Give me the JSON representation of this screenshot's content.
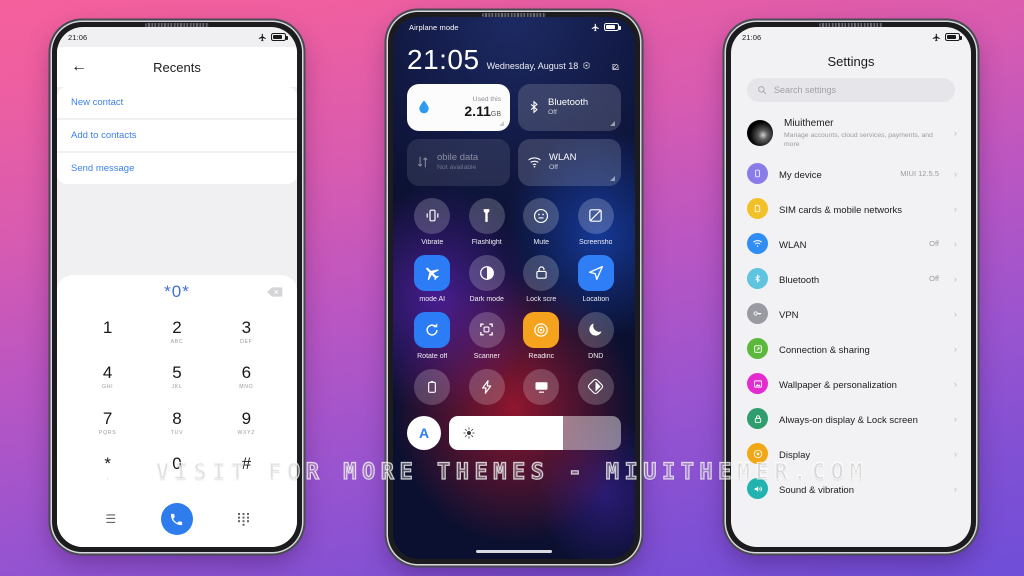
{
  "background": {
    "top_color": "#f5609c",
    "bottom_color": "#6f4ed8"
  },
  "watermark": {
    "text": "VISIT FOR MORE THEMES - MIUITHEMER.COM"
  },
  "left_phone": {
    "status_bar": {
      "time": "21:06",
      "airplane_icon": "airplane-icon",
      "battery_icon": "battery-icon"
    },
    "header": {
      "back_icon": "back-arrow-icon",
      "title": "Recents"
    },
    "actions": [
      {
        "label": "New contact"
      },
      {
        "label": "Add to contacts"
      },
      {
        "label": "Send message"
      }
    ],
    "dialer": {
      "number": "*0*",
      "delete_icon": "backspace-icon",
      "keys": [
        {
          "digit": "1",
          "letters": ""
        },
        {
          "digit": "2",
          "letters": "ABC"
        },
        {
          "digit": "3",
          "letters": "DEF"
        },
        {
          "digit": "4",
          "letters": "GHI"
        },
        {
          "digit": "5",
          "letters": "JKL"
        },
        {
          "digit": "6",
          "letters": "MNO"
        },
        {
          "digit": "7",
          "letters": "PQRS"
        },
        {
          "digit": "8",
          "letters": "TUV"
        },
        {
          "digit": "9",
          "letters": "WXYZ"
        },
        {
          "digit": "*",
          "letters": ","
        },
        {
          "digit": "0",
          "letters": "+"
        },
        {
          "digit": "#",
          "letters": ""
        }
      ],
      "menu_icon": "menu-lines-icon",
      "call_icon": "phone-handset-icon",
      "keypad_icon": "keypad-dots-icon"
    }
  },
  "center_phone": {
    "status_bar": {
      "label": "Airplane mode",
      "airplane_icon": "airplane-icon",
      "battery_icon": "battery-icon"
    },
    "clock": {
      "time": "21:05",
      "date": "Wednesday, August 18",
      "settings_icon": "gear-icon",
      "edit_icon": "edit-pencil-icon"
    },
    "big_tiles": [
      {
        "name": "data-usage",
        "icon": "water-drop-icon",
        "caption": "Used this",
        "amount": "2.11",
        "unit": "GB",
        "style": "white"
      },
      {
        "name": "bluetooth",
        "icon": "bluetooth-icon",
        "title": "Bluetooth",
        "sub": "Off",
        "style": "glass"
      },
      {
        "name": "mobile-data",
        "icon": "data-arrows-icon",
        "title": "obile data",
        "sub": "Not available",
        "style": "dim"
      },
      {
        "name": "wlan",
        "icon": "wifi-icon",
        "title": "WLAN",
        "sub": "Off",
        "style": "glass"
      }
    ],
    "tiles": [
      {
        "label": "Vibrate",
        "icon": "vibrate-icon",
        "state": "off"
      },
      {
        "label": "Flashlight",
        "icon": "flashlight-icon",
        "state": "off"
      },
      {
        "label": "Mute",
        "icon": "mute-face-icon",
        "state": "off"
      },
      {
        "label": "Screensho",
        "icon": "screenshot-icon",
        "state": "off"
      },
      {
        "label": "mode   AI",
        "icon": "airplane-icon",
        "state": "on-blue-square"
      },
      {
        "label": "Dark mode",
        "icon": "contrast-icon",
        "state": "off"
      },
      {
        "label": "Lock scre",
        "icon": "lock-icon",
        "state": "off"
      },
      {
        "label": "Location",
        "icon": "location-arrow-icon",
        "state": "on-blue-square"
      },
      {
        "label": "Rotate off",
        "icon": "rotate-icon",
        "state": "on-blue-square"
      },
      {
        "label": "Scanner",
        "icon": "scanner-icon",
        "state": "off"
      },
      {
        "label": "Readinc",
        "icon": "reading-eye-icon",
        "state": "on-orange-square"
      },
      {
        "label": "DND",
        "icon": "moon-icon",
        "state": "off"
      },
      {
        "label": "",
        "icon": "battery-saver-icon",
        "state": "off"
      },
      {
        "label": "",
        "icon": "bolt-icon",
        "state": "off"
      },
      {
        "label": "",
        "icon": "cast-screen-icon",
        "state": "off"
      },
      {
        "label": "",
        "icon": "half-contrast-icon",
        "state": "off"
      }
    ],
    "brightness": {
      "auto_label": "A",
      "sun_icon": "sun-icon",
      "level_percent": 66
    }
  },
  "right_phone": {
    "status_bar": {
      "time": "21:06",
      "airplane_icon": "airplane-icon",
      "battery_icon": "battery-icon"
    },
    "title": "Settings",
    "search": {
      "icon": "search-icon",
      "placeholder": "Search settings"
    },
    "account": {
      "name": "Miuithemer",
      "sub": "Manage accounts, cloud services, payments, and more",
      "avatar": "avatar",
      "chevron": "chevron-right-icon"
    },
    "items": [
      {
        "label": "My device",
        "value": "MIUI 12.5.5",
        "icon": "phone-icon",
        "color": "#8a7ce8"
      },
      {
        "label": "SIM cards & mobile networks",
        "value": "",
        "icon": "sim-card-icon",
        "color": "#f2c027"
      },
      {
        "label": "WLAN",
        "value": "Off",
        "icon": "wifi-icon",
        "color": "#2f8df5"
      },
      {
        "label": "Bluetooth",
        "value": "Off",
        "icon": "bluetooth-icon",
        "color": "#5ec4e0"
      },
      {
        "label": "VPN",
        "value": "",
        "icon": "vpn-key-icon",
        "color": "#9a9aa2"
      },
      {
        "label": "Connection & sharing",
        "value": "",
        "icon": "sharing-icon",
        "color": "#5bb83a"
      },
      {
        "label": "Wallpaper & personalization",
        "value": "",
        "icon": "wallpaper-icon",
        "color": "#e42bd0"
      },
      {
        "label": "Always-on display & Lock screen",
        "value": "",
        "icon": "lock-icon",
        "color": "#2f9d6e"
      },
      {
        "label": "Display",
        "value": "",
        "icon": "brightness-icon",
        "color": "#f2a816"
      },
      {
        "label": "Sound & vibration",
        "value": "",
        "icon": "volume-icon",
        "color": "#22b3b0"
      }
    ]
  }
}
